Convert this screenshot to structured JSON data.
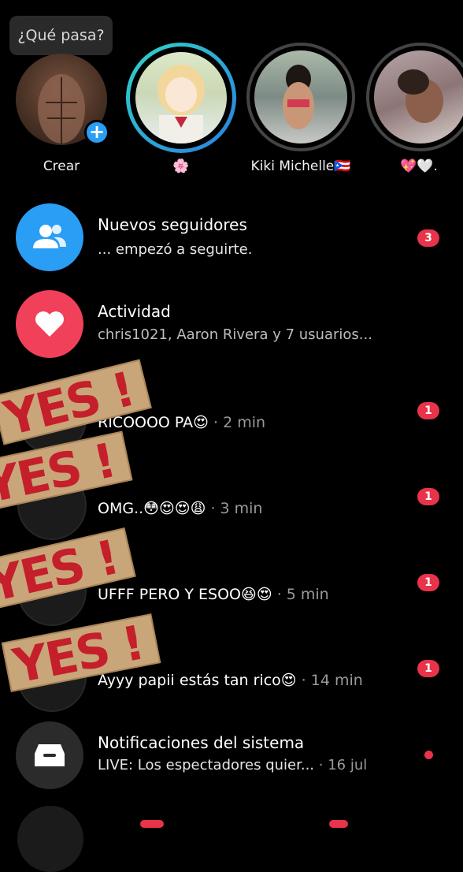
{
  "composer": {
    "placeholder": "¿Qué pasa?"
  },
  "stories": [
    {
      "label": "Crear",
      "action": "+"
    },
    {
      "label": "🌸"
    },
    {
      "label": "Kiki Michelle🇵🇷"
    },
    {
      "label": "💖🤍."
    }
  ],
  "notifications": {
    "followers": {
      "title": "Nuevos seguidores",
      "subtitle": "... empezó a seguirte.",
      "badge": "3"
    },
    "activity": {
      "title": "Actividad",
      "subtitle": "chris1021, Aaron Rivera y 7 usuarios..."
    }
  },
  "messages": [
    {
      "preview": "RICOOOO PA😍",
      "time": "· 2 min",
      "badge": "1"
    },
    {
      "preview": "OMG..😳😍😍😩",
      "time": "· 3 min",
      "badge": "1"
    },
    {
      "preview": "UFFF PERO Y ESOO😆😍",
      "time": "· 5 min",
      "badge": "1"
    },
    {
      "preview": "Ayyy papii estás tan rico😍",
      "time": "· 14 min",
      "badge": "1"
    }
  ],
  "system": {
    "title": "Notificaciones del sistema",
    "subtitle": "LIVE: Los espectadores quier...",
    "time": "· 16 jul"
  },
  "stamps": [
    "YES !",
    "YES !",
    "YES !",
    "YES !"
  ],
  "colors": {
    "accent_blue": "#2a9df4",
    "accent_red": "#e8334a",
    "activity_red": "#f0405a",
    "stamp_paper": "#c9a67a",
    "stamp_ink": "#c41f2a"
  }
}
